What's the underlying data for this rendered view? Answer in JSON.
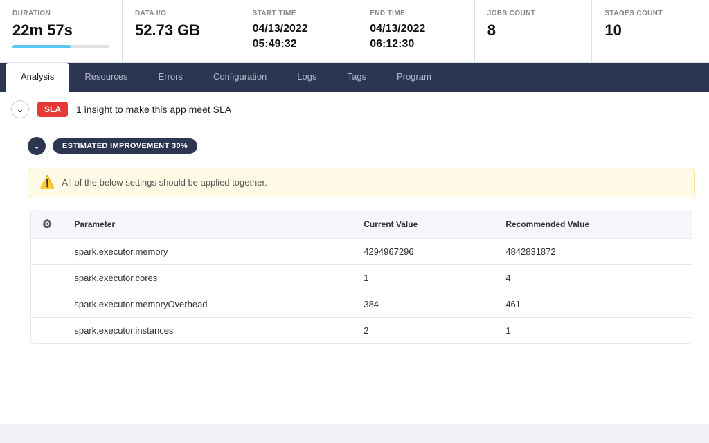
{
  "metrics": [
    {
      "id": "duration",
      "label": "DURATION",
      "value": "22m 57s",
      "has_progress": true,
      "multiline": false
    },
    {
      "id": "data-io",
      "label": "DATA I/O",
      "value": "52.73 GB",
      "has_progress": false,
      "multiline": false
    },
    {
      "id": "start-time",
      "label": "START TIME",
      "value": "04/13/2022",
      "value2": "05:49:32",
      "has_progress": false,
      "multiline": true
    },
    {
      "id": "end-time",
      "label": "END TIME",
      "value": "04/13/2022",
      "value2": "06:12:30",
      "has_progress": false,
      "multiline": true
    },
    {
      "id": "jobs-count",
      "label": "JOBS COUNT",
      "value": "8",
      "has_progress": false,
      "multiline": false
    },
    {
      "id": "stages-count",
      "label": "STAGES COUNT",
      "value": "10",
      "has_progress": false,
      "multiline": false
    }
  ],
  "tabs": [
    {
      "id": "analysis",
      "label": "Analysis",
      "active": true
    },
    {
      "id": "resources",
      "label": "Resources",
      "active": false
    },
    {
      "id": "errors",
      "label": "Errors",
      "active": false
    },
    {
      "id": "configuration",
      "label": "Configuration",
      "active": false
    },
    {
      "id": "logs",
      "label": "Logs",
      "active": false
    },
    {
      "id": "tags",
      "label": "Tags",
      "active": false
    },
    {
      "id": "program",
      "label": "Program",
      "active": false
    }
  ],
  "sla": {
    "badge_label": "SLA",
    "message": "1 insight to make this app meet SLA"
  },
  "insight": {
    "improvement_label": "ESTIMATED IMPROVEMENT 30%",
    "warning_text": "All of the below settings should be applied together.",
    "table": {
      "headers": [
        "Parameter",
        "Current Value",
        "Recommended Value"
      ],
      "rows": [
        {
          "parameter": "spark.executor.memory",
          "current": "4294967296",
          "recommended": "4842831872"
        },
        {
          "parameter": "spark.executor.cores",
          "current": "1",
          "recommended": "4"
        },
        {
          "parameter": "spark.executor.memoryOverhead",
          "current": "384",
          "recommended": "461"
        },
        {
          "parameter": "spark.executor.instances",
          "current": "2",
          "recommended": "1"
        }
      ]
    }
  }
}
